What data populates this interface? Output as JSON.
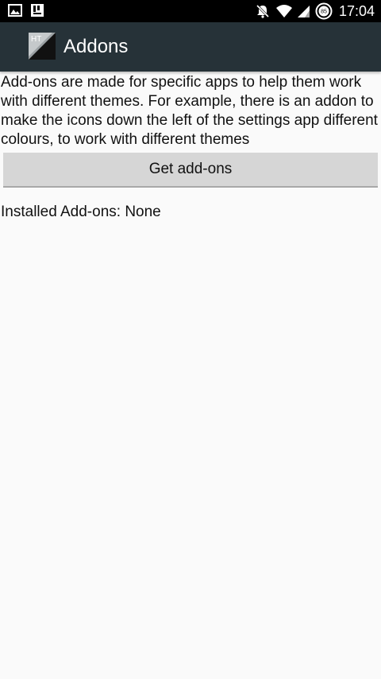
{
  "status_bar": {
    "time": "17:04",
    "battery_level": "85",
    "icons": [
      "gallery-icon",
      "notes-icon",
      "muted-bell-icon",
      "wifi-icon",
      "signal-icon",
      "battery-icon"
    ]
  },
  "app_bar": {
    "logo_text": "HT",
    "title": "Addons",
    "background_color": "#263238"
  },
  "main": {
    "description": "Add-ons are made for specific apps to help them work with different themes. For example, there is an addon to make the icons down the left of the settings app different colours, to work with different themes",
    "get_addons_label": "Get add-ons",
    "installed_label": "Installed Add-ons:",
    "installed_value": "None"
  }
}
